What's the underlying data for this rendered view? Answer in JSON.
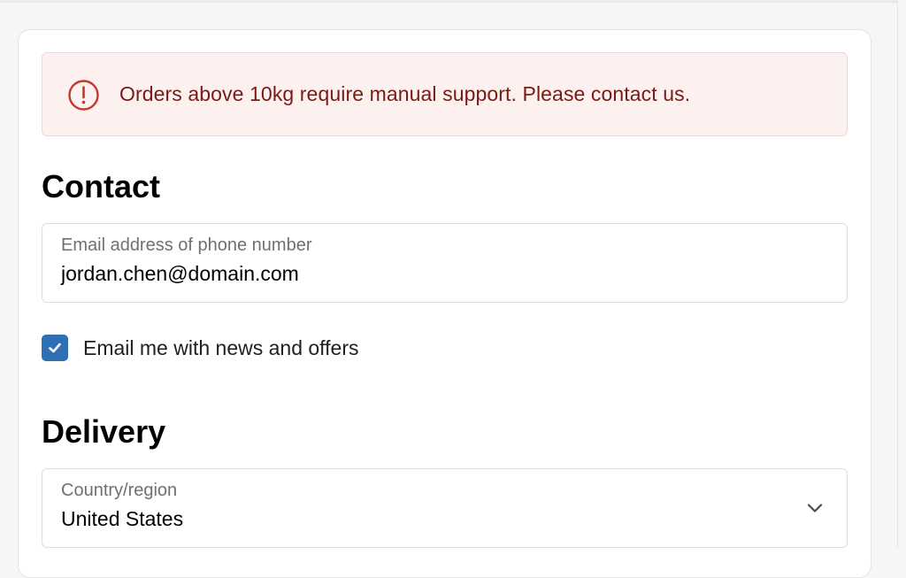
{
  "alert": {
    "icon": "exclamation-circle-icon",
    "message": "Orders above 10kg require manual support. Please contact us.",
    "color": "#7a1a14",
    "background": "#fdf1f0"
  },
  "contact": {
    "title": "Contact",
    "email_field": {
      "label": "Email address of phone number",
      "value": "jordan.chen@domain.com"
    },
    "newsletter": {
      "label": "Email me with news and offers",
      "checked": true,
      "color": "#2f6fb3"
    }
  },
  "delivery": {
    "title": "Delivery",
    "country_field": {
      "label": "Country/region",
      "value": "United States",
      "icon": "chevron-down-icon"
    }
  }
}
